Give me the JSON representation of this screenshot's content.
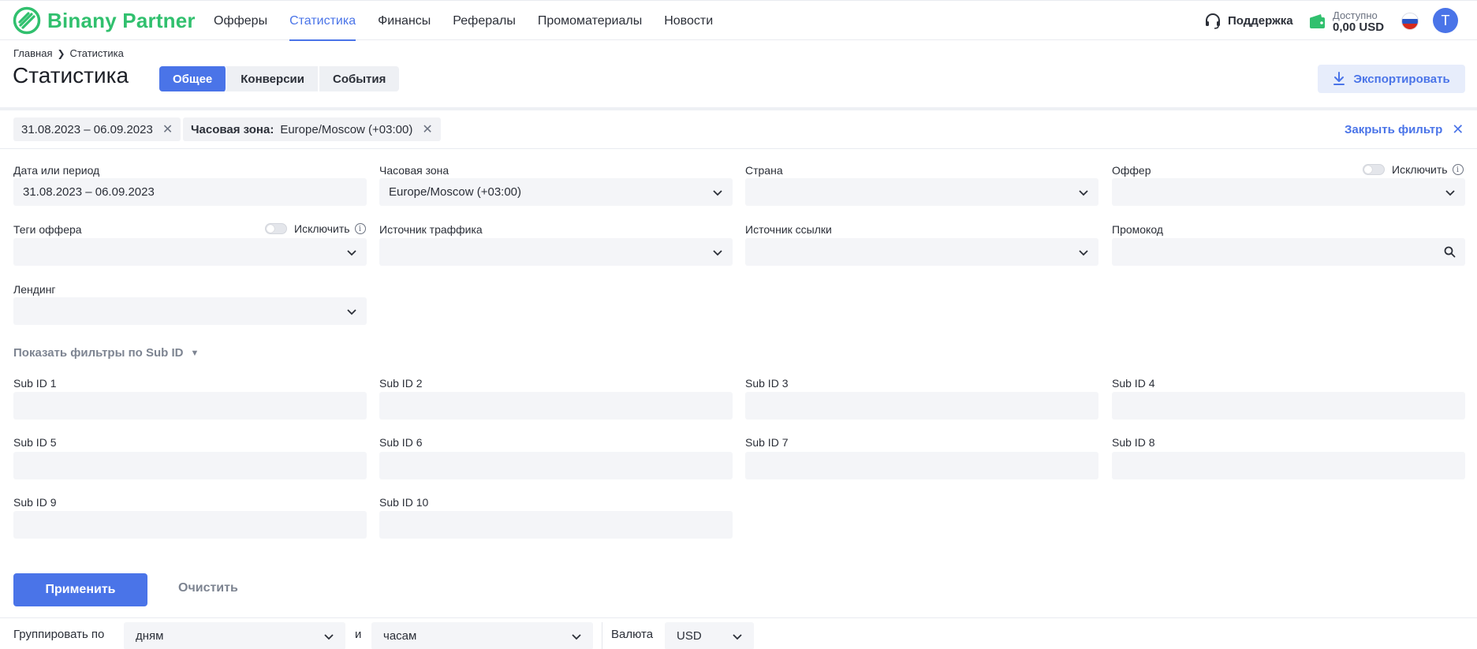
{
  "brand": {
    "name": "Binany Partner",
    "color": "#31c06e"
  },
  "nav": [
    {
      "label": "Офферы",
      "active": false
    },
    {
      "label": "Статистика",
      "active": true
    },
    {
      "label": "Финансы",
      "active": false
    },
    {
      "label": "Рефералы",
      "active": false
    },
    {
      "label": "Промоматериалы",
      "active": false
    },
    {
      "label": "Новости",
      "active": false
    }
  ],
  "header": {
    "support_label": "Поддержка",
    "balance_label": "Доступно",
    "balance_value": "0,00 USD",
    "avatar_initial": "T",
    "language_flag": "russia-flag-icon"
  },
  "breadcrumb": {
    "home": "Главная",
    "current": "Статистика"
  },
  "page": {
    "title": "Статистика",
    "tabs": [
      {
        "label": "Общее",
        "active": true
      },
      {
        "label": "Конверсии",
        "active": false
      },
      {
        "label": "События",
        "active": false
      }
    ],
    "export_label": "Экспортировать"
  },
  "active_filters": {
    "date_chip": "31.08.2023 – 06.09.2023",
    "tz_chip_key": "Часовая зона:",
    "tz_chip_value": "Europe/Moscow (+03:00)",
    "close_label": "Закрыть фильтр"
  },
  "filters": {
    "date": {
      "label": "Дата или период",
      "value": "31.08.2023 – 06.09.2023"
    },
    "timezone": {
      "label": "Часовая зона",
      "value": "Europe/Moscow (+03:00)"
    },
    "country": {
      "label": "Страна",
      "value": ""
    },
    "offer": {
      "label": "Оффер",
      "value": "",
      "exclude_label": "Исключить"
    },
    "offer_tags": {
      "label": "Теги оффера",
      "value": "",
      "exclude_label": "Исключить"
    },
    "traffic_source": {
      "label": "Источник траффика",
      "value": ""
    },
    "link_source": {
      "label": "Источник ссылки",
      "value": ""
    },
    "promocode": {
      "label": "Промокод",
      "value": ""
    },
    "landing": {
      "label": "Лендинг",
      "value": ""
    }
  },
  "subid": {
    "toggle_label": "Показать фильтры по Sub ID",
    "labels": [
      "Sub ID 1",
      "Sub ID 2",
      "Sub ID 3",
      "Sub ID 4",
      "Sub ID 5",
      "Sub ID 6",
      "Sub ID 7",
      "Sub ID 8",
      "Sub ID 9",
      "Sub ID 10"
    ]
  },
  "actions": {
    "apply_label": "Применить",
    "clear_label": "Очистить"
  },
  "grouping": {
    "label": "Группировать по",
    "primary_value": "дням",
    "conjunction": "и",
    "secondary_value": "часам",
    "currency_label": "Валюта",
    "currency_value": "USD"
  },
  "colors": {
    "accent": "#4a74e8",
    "field_bg": "#f4f5f8"
  }
}
